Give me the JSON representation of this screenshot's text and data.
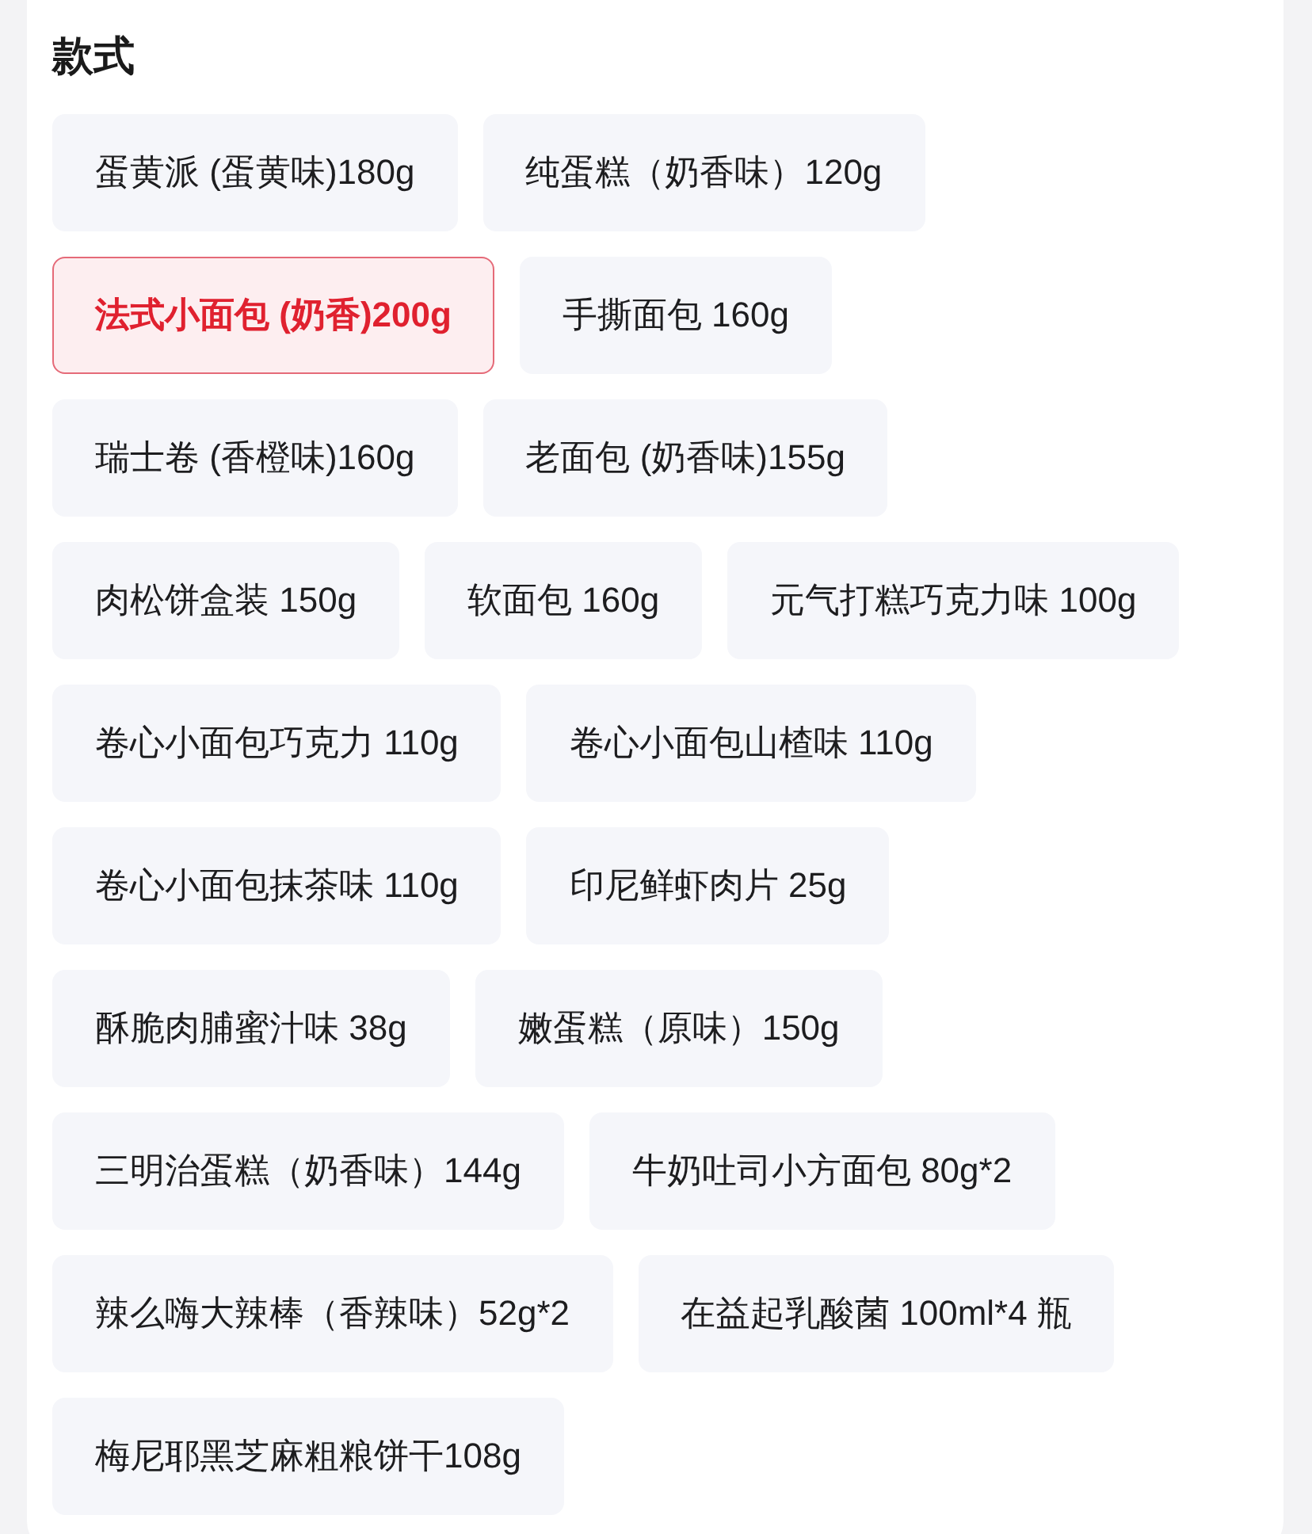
{
  "section": {
    "title": "款式"
  },
  "options": [
    {
      "label": "蛋黄派 (蛋黄味)180g",
      "selected": false
    },
    {
      "label": "纯蛋糕（奶香味）120g",
      "selected": false
    },
    {
      "label": "法式小面包 (奶香)200g",
      "selected": true
    },
    {
      "label": "手撕面包 160g",
      "selected": false
    },
    {
      "label": "瑞士卷 (香橙味)160g",
      "selected": false
    },
    {
      "label": "老面包 (奶香味)155g",
      "selected": false
    },
    {
      "label": "肉松饼盒装 150g",
      "selected": false
    },
    {
      "label": "软面包 160g",
      "selected": false
    },
    {
      "label": "元气打糕巧克力味 100g",
      "selected": false
    },
    {
      "label": "卷心小面包巧克力 110g",
      "selected": false
    },
    {
      "label": "卷心小面包山楂味 110g",
      "selected": false
    },
    {
      "label": "卷心小面包抹茶味 110g",
      "selected": false
    },
    {
      "label": "印尼鲜虾肉片 25g",
      "selected": false
    },
    {
      "label": "酥脆肉脯蜜汁味 38g",
      "selected": false
    },
    {
      "label": "嫩蛋糕（原味）150g",
      "selected": false
    },
    {
      "label": "三明治蛋糕（奶香味）144g",
      "selected": false
    },
    {
      "label": "牛奶吐司小方面包 80g*2",
      "selected": false
    },
    {
      "label": "辣么嗨大辣棒（香辣味）52g*2",
      "selected": false
    },
    {
      "label": "在益起乳酸菌 100ml*4 瓶",
      "selected": false
    },
    {
      "label": "梅尼耶黑芝麻粗粮饼干108g",
      "selected": false
    }
  ]
}
